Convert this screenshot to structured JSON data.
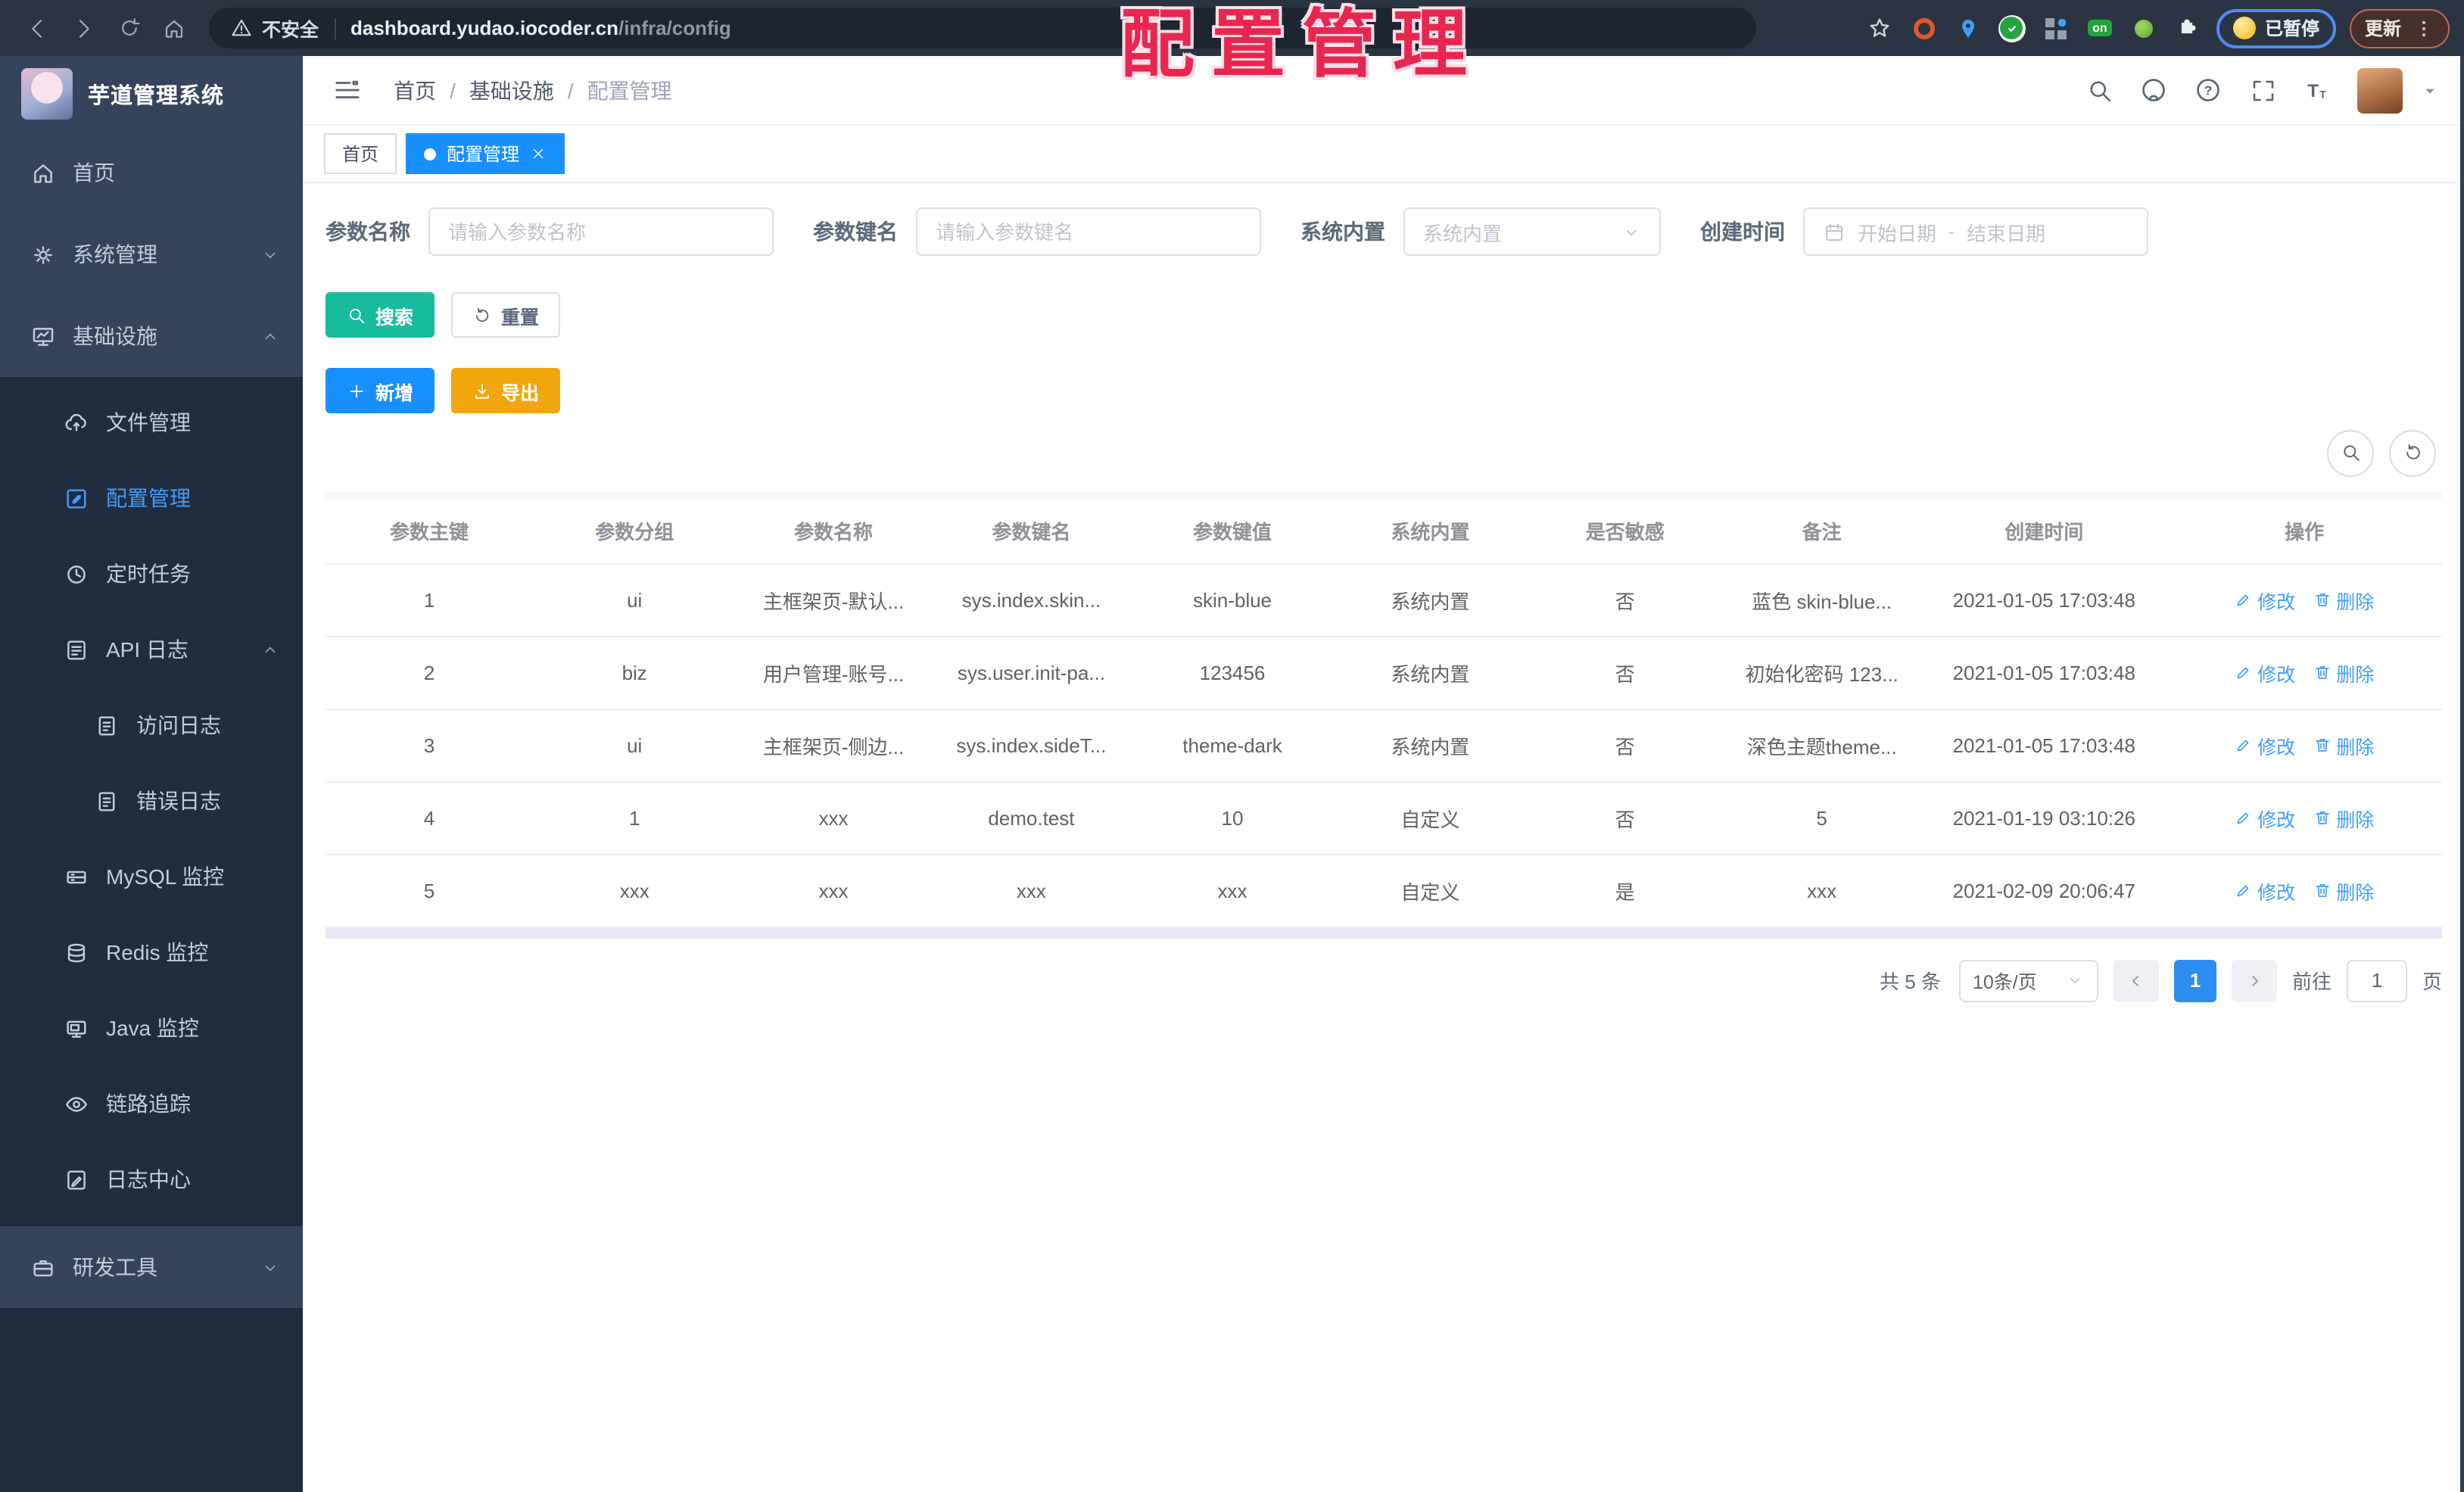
{
  "overlay": {
    "title": "配置管理"
  },
  "browser": {
    "security_text": "不安全",
    "url_host": "dashboard.yudao.iocoder.cn",
    "url_path": "/infra/config",
    "ext_on_label": "on",
    "paused_label": "已暂停",
    "update_label": "更新"
  },
  "sidebar": {
    "logo_title": "芋道管理系统",
    "items": [
      {
        "name": "home",
        "label": "首页",
        "icon": "home",
        "level": 1,
        "section": "top"
      },
      {
        "name": "system-mgmt",
        "label": "系统管理",
        "icon": "gear",
        "level": 1,
        "section": "top",
        "arrow": "down"
      },
      {
        "name": "infra",
        "label": "基础设施",
        "icon": "monitor",
        "level": 1,
        "section": "top",
        "arrow": "up"
      },
      {
        "name": "file-mgmt",
        "label": "文件管理",
        "icon": "cloud",
        "level": 2,
        "section": "sub"
      },
      {
        "name": "config-mgmt",
        "label": "配置管理",
        "icon": "editsq",
        "level": 2,
        "section": "sub",
        "active": true
      },
      {
        "name": "cron-job",
        "label": "定时任务",
        "icon": "clock",
        "level": 2,
        "section": "sub"
      },
      {
        "name": "api-log",
        "label": "API 日志",
        "icon": "apilog",
        "level": 2,
        "section": "sub",
        "arrow": "up"
      },
      {
        "name": "access-log",
        "label": "访问日志",
        "icon": "doc",
        "level": 3,
        "section": "sub"
      },
      {
        "name": "error-log",
        "label": "错误日志",
        "icon": "doc",
        "level": 3,
        "section": "sub"
      },
      {
        "name": "mysql-monitor",
        "label": "MySQL 监控",
        "icon": "mysql",
        "level": 2,
        "section": "sub"
      },
      {
        "name": "redis-monitor",
        "label": "Redis 监控",
        "icon": "redis",
        "level": 2,
        "section": "sub"
      },
      {
        "name": "java-monitor",
        "label": "Java 监控",
        "icon": "java",
        "level": 2,
        "section": "sub"
      },
      {
        "name": "tracing",
        "label": "链路追踪",
        "icon": "eye",
        "level": 2,
        "section": "sub"
      },
      {
        "name": "log-center",
        "label": "日志中心",
        "icon": "logcenter",
        "level": 2,
        "section": "sub"
      },
      {
        "name": "dev-tools",
        "label": "研发工具",
        "icon": "brief",
        "level": 1,
        "section": "bottom",
        "arrow": "down"
      }
    ]
  },
  "header": {
    "breadcrumb": [
      "首页",
      "基础设施",
      "配置管理"
    ]
  },
  "tabs": [
    {
      "label": "首页",
      "active": false
    },
    {
      "label": "配置管理",
      "active": true
    }
  ],
  "filters": {
    "name": {
      "label": "参数名称",
      "placeholder": "请输入参数名称"
    },
    "key": {
      "label": "参数键名",
      "placeholder": "请输入参数键名"
    },
    "type": {
      "label": "系统内置",
      "placeholder": "系统内置"
    },
    "create_time": {
      "label": "创建时间",
      "start_placeholder": "开始日期",
      "separator": "-",
      "end_placeholder": "结束日期"
    }
  },
  "actions": {
    "search": "搜索",
    "reset": "重置",
    "add": "新增",
    "export": "导出"
  },
  "table": {
    "columns": [
      "参数主键",
      "参数分组",
      "参数名称",
      "参数键名",
      "参数键值",
      "系统内置",
      "是否敏感",
      "备注",
      "创建时间",
      "操作"
    ],
    "rows": [
      [
        "1",
        "ui",
        "主框架页-默认...",
        "sys.index.skin...",
        "skin-blue",
        "系统内置",
        "否",
        "蓝色 skin-blue...",
        "2021-01-05 17:03:48"
      ],
      [
        "2",
        "biz",
        "用户管理-账号...",
        "sys.user.init-pa...",
        "123456",
        "系统内置",
        "否",
        "初始化密码 123...",
        "2021-01-05 17:03:48"
      ],
      [
        "3",
        "ui",
        "主框架页-侧边...",
        "sys.index.sideT...",
        "theme-dark",
        "系统内置",
        "否",
        "深色主题theme...",
        "2021-01-05 17:03:48"
      ],
      [
        "4",
        "1",
        "xxx",
        "demo.test",
        "10",
        "自定义",
        "否",
        "5",
        "2021-01-19 03:10:26"
      ],
      [
        "5",
        "xxx",
        "xxx",
        "xxx",
        "xxx",
        "自定义",
        "是",
        "xxx",
        "2021-02-09 20:06:47"
      ]
    ],
    "row_actions": {
      "edit": "修改",
      "delete": "删除"
    }
  },
  "pagination": {
    "total": "共 5 条",
    "page_size": "10条/页",
    "current_page": "1",
    "goto_label": "前往",
    "goto_value": "1",
    "page_label": "页"
  }
}
